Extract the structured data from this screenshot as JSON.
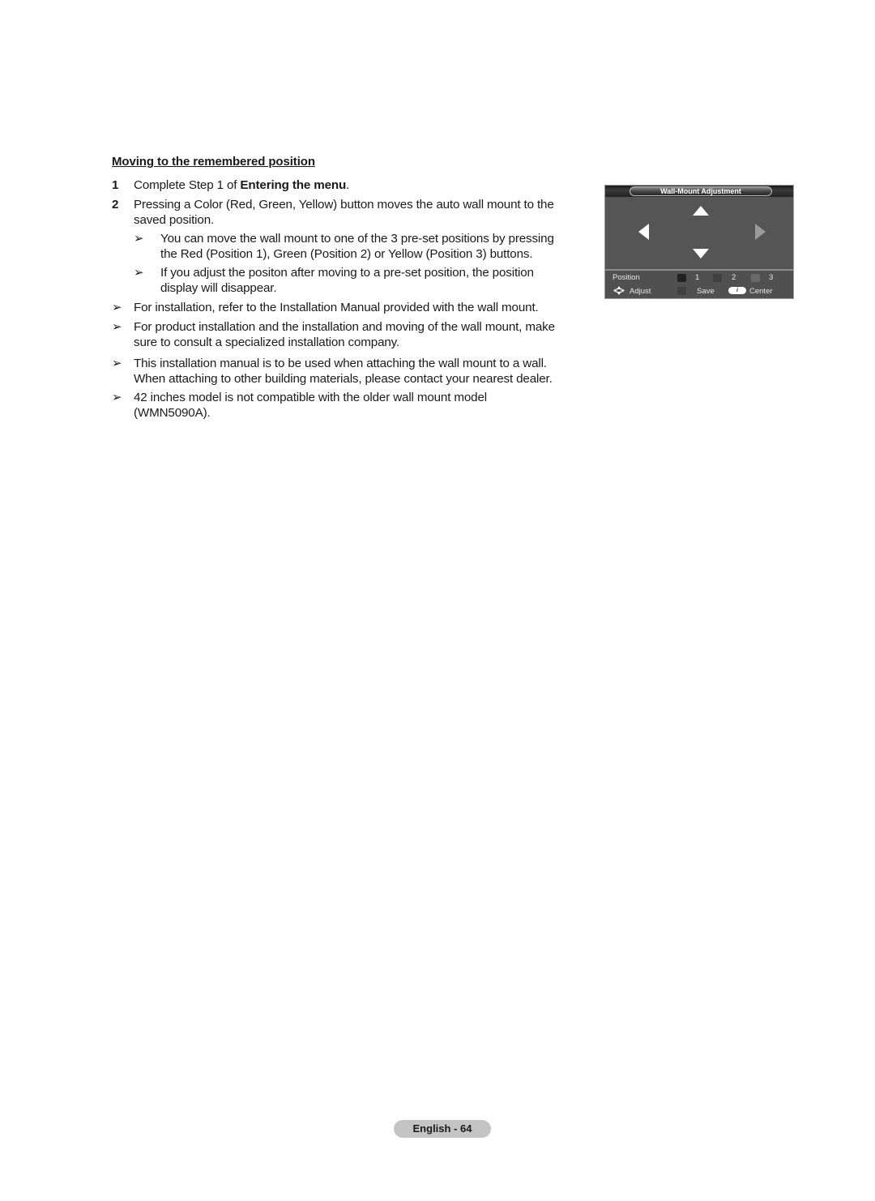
{
  "section": {
    "heading": "Moving to the remembered position",
    "steps": [
      {
        "number": "1",
        "text_before": "Complete Step 1 of ",
        "text_bold": "Entering the menu",
        "text_after": "."
      },
      {
        "number": "2",
        "line1": "Pressing a Color (Red, Green, Yellow) button moves the auto wall mount to the",
        "line2": "saved position."
      }
    ],
    "sub_notes": [
      {
        "line1": "You can move the wall mount to one of the 3 pre-set positions by pressing",
        "line2": "the Red (Position 1), Green (Position 2) or Yellow (Position 3) buttons."
      },
      {
        "line1": "If you adjust the positon after moving to a pre-set position, the position",
        "line2": "display will disappear."
      }
    ],
    "notes": [
      {
        "line1": "For installation, refer to the Installation Manual provided with the wall mount."
      },
      {
        "line1": "For product installation and the installation and moving of the wall mount, make",
        "line2": "sure to consult a specialized installation company."
      },
      {
        "line1": "This installation manual is to be used when attaching the wall mount to a wall.",
        "line2": "When attaching to other building materials, please contact your nearest dealer."
      },
      {
        "line1": "42 inches model is not compatible with the older wall mount model",
        "line2": "(WMN5090A)."
      }
    ],
    "note_arrow_glyph": "➢"
  },
  "osd": {
    "title": "Wall-Mount Adjustment",
    "arrows": [
      "up-arrow",
      "down-arrow",
      "left-arrow",
      "right-arrow"
    ],
    "footer": {
      "position_label": "Position",
      "positions": [
        {
          "label": "1",
          "color": "#222222"
        },
        {
          "label": "2",
          "color": "#404040"
        },
        {
          "label": "3",
          "color": "#6a6a6a"
        }
      ],
      "adjust_label": "Adjust",
      "save_label": "Save",
      "save_color": "#404040",
      "info_glyph": "i",
      "center_label": "Center"
    }
  },
  "footer": {
    "page_label": "English - 64"
  }
}
